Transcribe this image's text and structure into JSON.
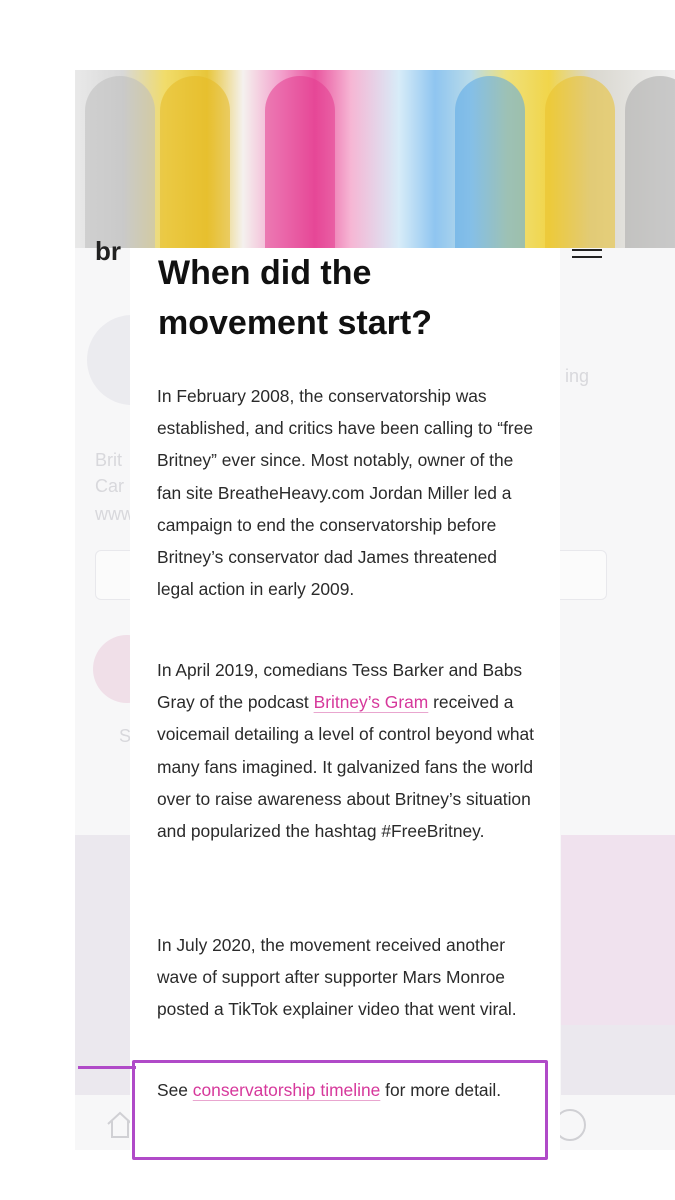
{
  "background": {
    "logo_fragment": "br",
    "profile_name_fragment": "Brit",
    "profile_desc_fragment": "Car",
    "profile_link_fragment": "www",
    "right_text_fragment": "ing",
    "highlight_label_fragment": "S"
  },
  "article": {
    "heading": "When did the movement start?",
    "paragraphs": [
      "In February 2008, the conservatorship was established, and critics have been calling to “free Britney” ever since. Most notably, owner of the fan site BreatheHeavy.com Jordan Miller led a campaign to end the conservatorship before Britney’s conservator dad James threatened legal action in early 2009.",
      "received a voicemail detailing a level of control beyond what many fans imagined. It galvanized fans the world over to raise awareness about Britney’s situation and popularized the hashtag #FreeBritney.",
      "In July 2020, the movement received another wave of support after supporter Mars Monroe posted a TikTok explainer video that went viral."
    ],
    "p2_before_link": "In April 2019, comedians Tess Barker and Babs Gray of the podcast ",
    "p2_link": "Britney’s Gram",
    "see_before": "See ",
    "see_link": "conservatorship timeline",
    "see_after": " for more detail."
  },
  "colors": {
    "link": "#d6389b",
    "annotation": "#b04ac8"
  }
}
